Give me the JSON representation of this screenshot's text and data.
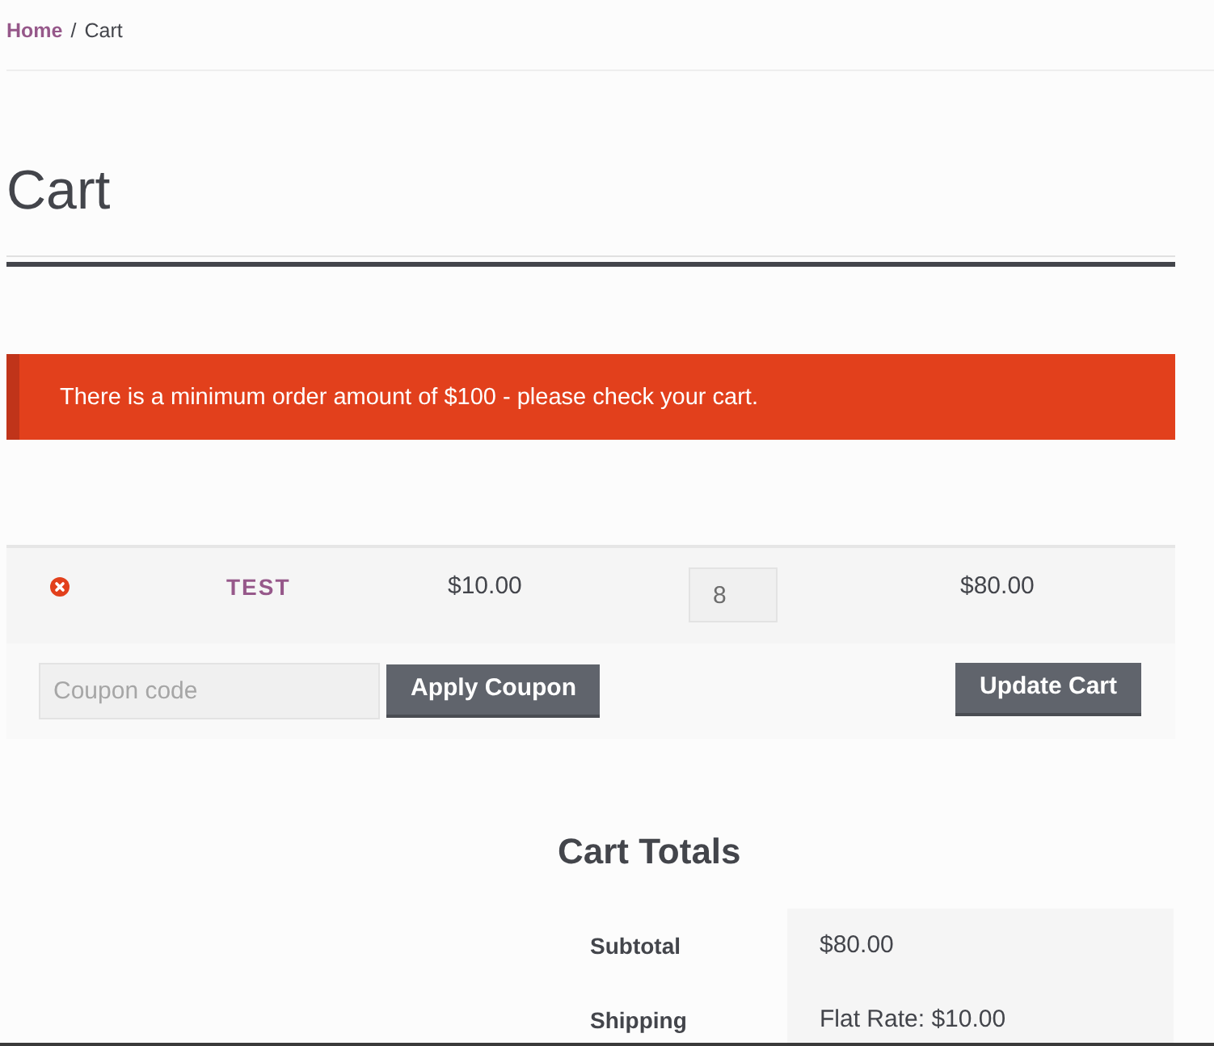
{
  "breadcrumb": {
    "separator": "/",
    "items": [
      {
        "label": "Home",
        "kind": "link"
      },
      {
        "label": "Cart",
        "kind": "current"
      }
    ]
  },
  "page_title": "Cart",
  "notice": {
    "kind": "error",
    "message": "There is a minimum order amount of $100 - please check your cart."
  },
  "cart_items": [
    {
      "product": "TEST",
      "price": "$10.00",
      "quantity": "8",
      "total": "$80.00"
    }
  ],
  "coupon": {
    "placeholder": "Coupon code",
    "button": "Apply Coupon"
  },
  "update_button": "Update Cart",
  "totals": {
    "title": "Cart Totals",
    "rows": [
      {
        "label": "Subtotal",
        "value": "$80.00"
      },
      {
        "label": "Shipping",
        "value": "Flat Rate: $10.00"
      }
    ]
  }
}
